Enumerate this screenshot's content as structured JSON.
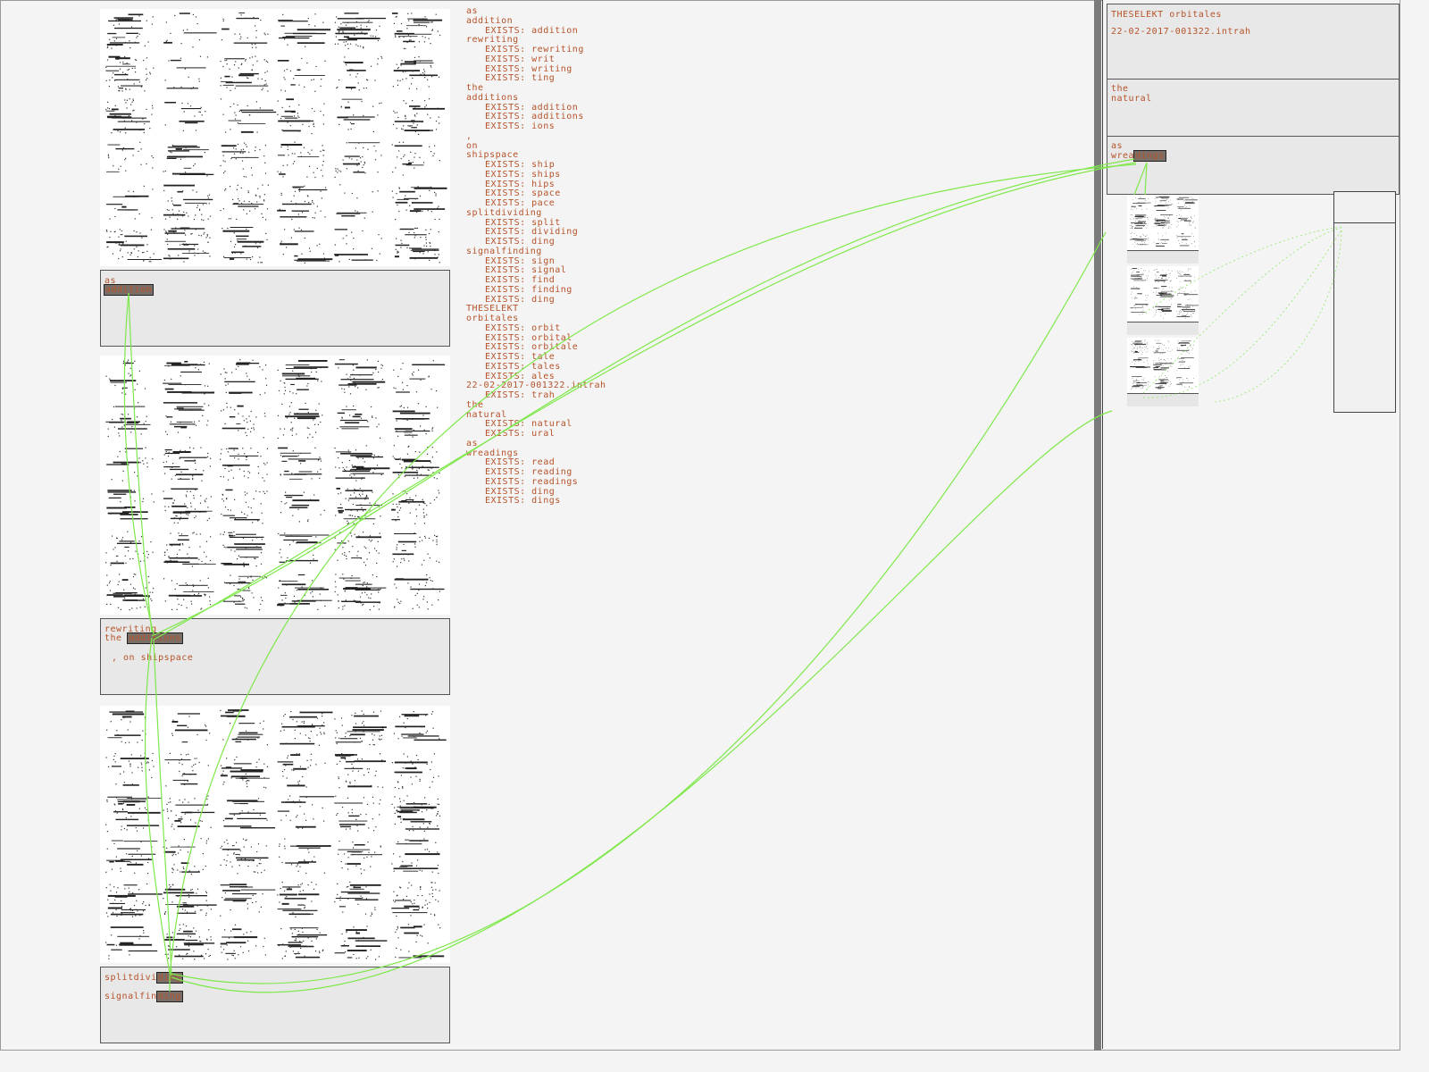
{
  "left": {
    "box1": {
      "line1": "as",
      "line2": "addition"
    },
    "box2": {
      "line1": "rewriting",
      "line2_prefix": "the ",
      "line2_hl": "additions",
      "line3": ", on shipspace"
    },
    "box3": {
      "line1_prefix": "splitdivi",
      "line1_hl": "ding",
      "line2_prefix": "signalfin",
      "line2_hl": "ding"
    }
  },
  "wordlist": [
    {
      "text": "as",
      "indent": false
    },
    {
      "text": "addition",
      "indent": false
    },
    {
      "text": "EXISTS: addition",
      "indent": true
    },
    {
      "text": "rewriting",
      "indent": false
    },
    {
      "text": "EXISTS: rewriting",
      "indent": true
    },
    {
      "text": "EXISTS: writ",
      "indent": true
    },
    {
      "text": "EXISTS: writing",
      "indent": true
    },
    {
      "text": "EXISTS: ting",
      "indent": true
    },
    {
      "text": "the",
      "indent": false
    },
    {
      "text": "additions",
      "indent": false
    },
    {
      "text": "EXISTS: addition",
      "indent": true
    },
    {
      "text": "EXISTS: additions",
      "indent": true
    },
    {
      "text": "EXISTS: ions",
      "indent": true
    },
    {
      "text": ",",
      "indent": false
    },
    {
      "text": "on",
      "indent": false
    },
    {
      "text": "shipspace",
      "indent": false
    },
    {
      "text": "EXISTS: ship",
      "indent": true
    },
    {
      "text": "EXISTS: ships",
      "indent": true
    },
    {
      "text": "EXISTS: hips",
      "indent": true
    },
    {
      "text": "EXISTS: space",
      "indent": true
    },
    {
      "text": "EXISTS: pace",
      "indent": true
    },
    {
      "text": "splitdividing",
      "indent": false
    },
    {
      "text": "EXISTS: split",
      "indent": true
    },
    {
      "text": "EXISTS: dividing",
      "indent": true
    },
    {
      "text": "EXISTS: ding",
      "indent": true
    },
    {
      "text": "signalfinding",
      "indent": false
    },
    {
      "text": "EXISTS: sign",
      "indent": true
    },
    {
      "text": "EXISTS: signal",
      "indent": true
    },
    {
      "text": "EXISTS: find",
      "indent": true
    },
    {
      "text": "EXISTS: finding",
      "indent": true
    },
    {
      "text": "EXISTS: ding",
      "indent": true
    },
    {
      "text": "THESELEKT",
      "indent": false
    },
    {
      "text": "orbitales",
      "indent": false
    },
    {
      "text": "EXISTS: orbit",
      "indent": true
    },
    {
      "text": "EXISTS: orbital",
      "indent": true
    },
    {
      "text": "EXISTS: orbitale",
      "indent": true
    },
    {
      "text": "EXISTS: tale",
      "indent": true
    },
    {
      "text": "EXISTS: tales",
      "indent": true
    },
    {
      "text": "EXISTS: ales",
      "indent": true
    },
    {
      "text": "22-02-2017-001322.intrah",
      "indent": false
    },
    {
      "text": "EXISTS: trah",
      "indent": true
    },
    {
      "text": "the",
      "indent": false
    },
    {
      "text": "natural",
      "indent": false
    },
    {
      "text": "EXISTS: natural",
      "indent": true
    },
    {
      "text": "EXISTS: ural",
      "indent": true
    },
    {
      "text": "as",
      "indent": false
    },
    {
      "text": "wreadings",
      "indent": false
    },
    {
      "text": "EXISTS: read",
      "indent": true
    },
    {
      "text": "EXISTS: reading",
      "indent": true
    },
    {
      "text": "EXISTS: readings",
      "indent": true
    },
    {
      "text": "EXISTS: ding",
      "indent": true
    },
    {
      "text": "EXISTS: dings",
      "indent": true
    }
  ],
  "right": {
    "box1": {
      "title": "THESELEKT orbitales",
      "line2": "22-02-2017-001322.intrah"
    },
    "box2": {
      "line1": "the",
      "line2": "natural"
    },
    "box3": {
      "line1": "as",
      "line2_prefix": "wrea",
      "line2_hl": "dings"
    }
  },
  "colors": {
    "text": "#b5532a",
    "link": "#7ee84a",
    "box": "#e8e8e8",
    "divider": "#7b7b7b"
  }
}
